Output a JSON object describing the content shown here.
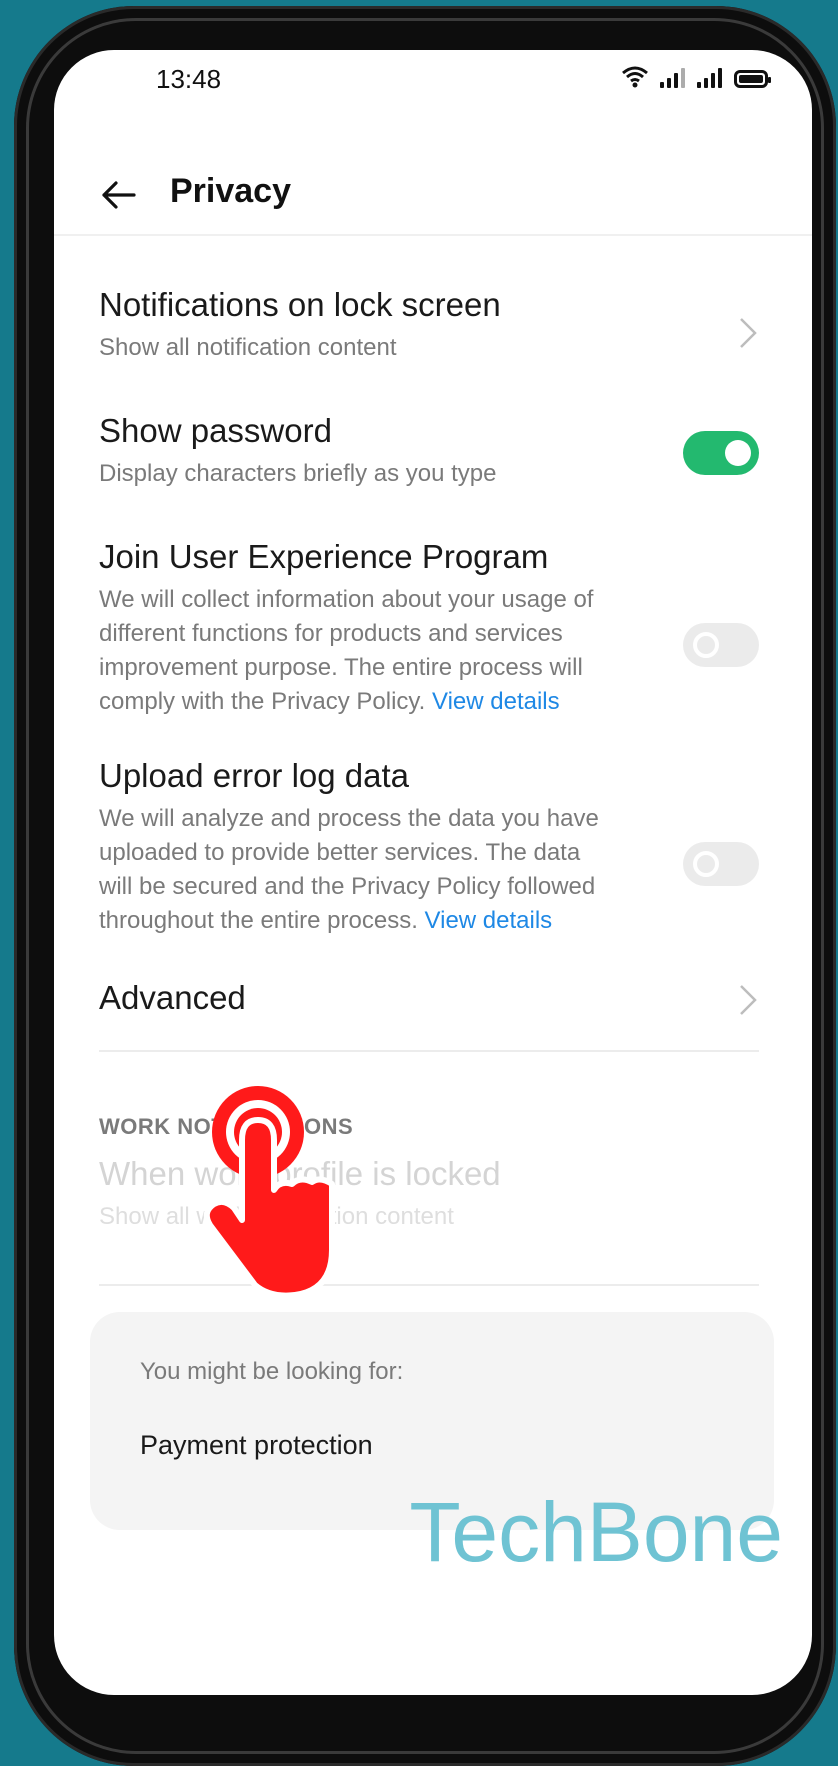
{
  "status_bar": {
    "time": "13:48",
    "icons": [
      "wifi-icon",
      "signal-icon",
      "signal-icon",
      "battery-icon"
    ]
  },
  "app_bar": {
    "title": "Privacy",
    "back_icon": "back-arrow-icon"
  },
  "settings": [
    {
      "title": "Notifications on lock screen",
      "subtitle": "Show all notification content",
      "control": "chevron"
    },
    {
      "title": "Show password",
      "subtitle": "Display characters briefly as you type",
      "control": "toggle",
      "toggle_on": true
    },
    {
      "title": "Join User Experience Program",
      "subtitle": "We will collect information about your usage of different functions for products and services improvement purpose. The entire process will comply with the Privacy Policy.",
      "link": "View details",
      "control": "toggle",
      "toggle_on": false
    },
    {
      "title": "Upload error log data",
      "subtitle": "We will analyze and process the data you have uploaded to provide better services. The data will be secured and the Privacy Policy followed throughout the entire process.",
      "link": "View details",
      "control": "toggle",
      "toggle_on": false
    },
    {
      "title": "Advanced",
      "control": "chevron"
    }
  ],
  "work_section": {
    "header": "WORK NOTIFICATIONS",
    "item_title": "When work profile is locked",
    "item_subtitle": "Show all work notification content"
  },
  "suggestions": {
    "header": "You might be looking for:",
    "items": [
      "Payment protection"
    ]
  },
  "watermark": "TechBone",
  "overlay": {
    "tap_indicator_icon": "tap-hand-icon",
    "color": "#ff1a1a"
  },
  "colors": {
    "toggle_on": "#23b96f",
    "link": "#1e88e5",
    "background": "#157a8c"
  }
}
